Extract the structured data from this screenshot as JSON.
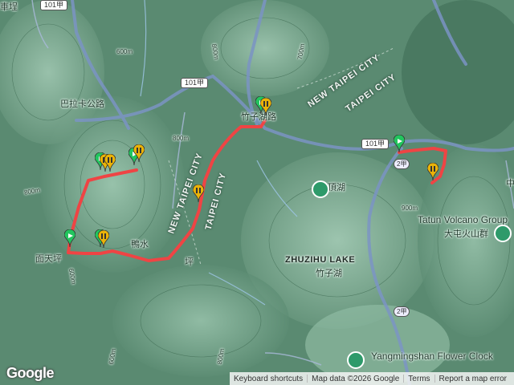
{
  "map": {
    "place_labels": {
      "chexing": "車埕",
      "balakagong_road": "巴拉卡公路",
      "zhuzihu_road": "竹子湖路",
      "dingu": "頂湖",
      "yashuiping": "鴨水",
      "guanpu": "坪",
      "miantian": "面天坪",
      "tatun_en": "Tatun Volcano Group",
      "tatun_zh": "大屯火山群",
      "zhuzihu_en": "ZHUZIHU LAKE",
      "zhuzihu_zh": "竹子湖",
      "flower_en": "Yangmingshan Flower Clock",
      "edge_char": "中"
    },
    "boundary_labels": {
      "new_taipei_1": "NEW TAIPEI CITY",
      "taipei_1": "TAIPEI CITY",
      "new_taipei_2": "NEW TAIPEI CITY",
      "taipei_2": "TAIPEI CITY"
    },
    "contour_labels": [
      "800m",
      "800m",
      "600m",
      "700m",
      "800m",
      "600m",
      "900m",
      "600m",
      "800m"
    ],
    "road_shields": {
      "r101_top": "101甲",
      "r101_mid": "101甲",
      "r101_right": "101甲",
      "r2_a": "2甲",
      "r2_b": "2甲"
    },
    "route_color": "#ef4444",
    "start_marker_color": "#22c55e",
    "pause_marker_color": "#eab308",
    "markers": [
      {
        "type": "start",
        "name": "start-marker"
      },
      {
        "type": "pause",
        "name": "pause-marker"
      }
    ]
  },
  "branding": {
    "logo": "Google"
  },
  "footer": {
    "shortcuts": "Keyboard shortcuts",
    "data": "Map data ©2026 Google",
    "terms": "Terms",
    "report": "Report a map error"
  }
}
